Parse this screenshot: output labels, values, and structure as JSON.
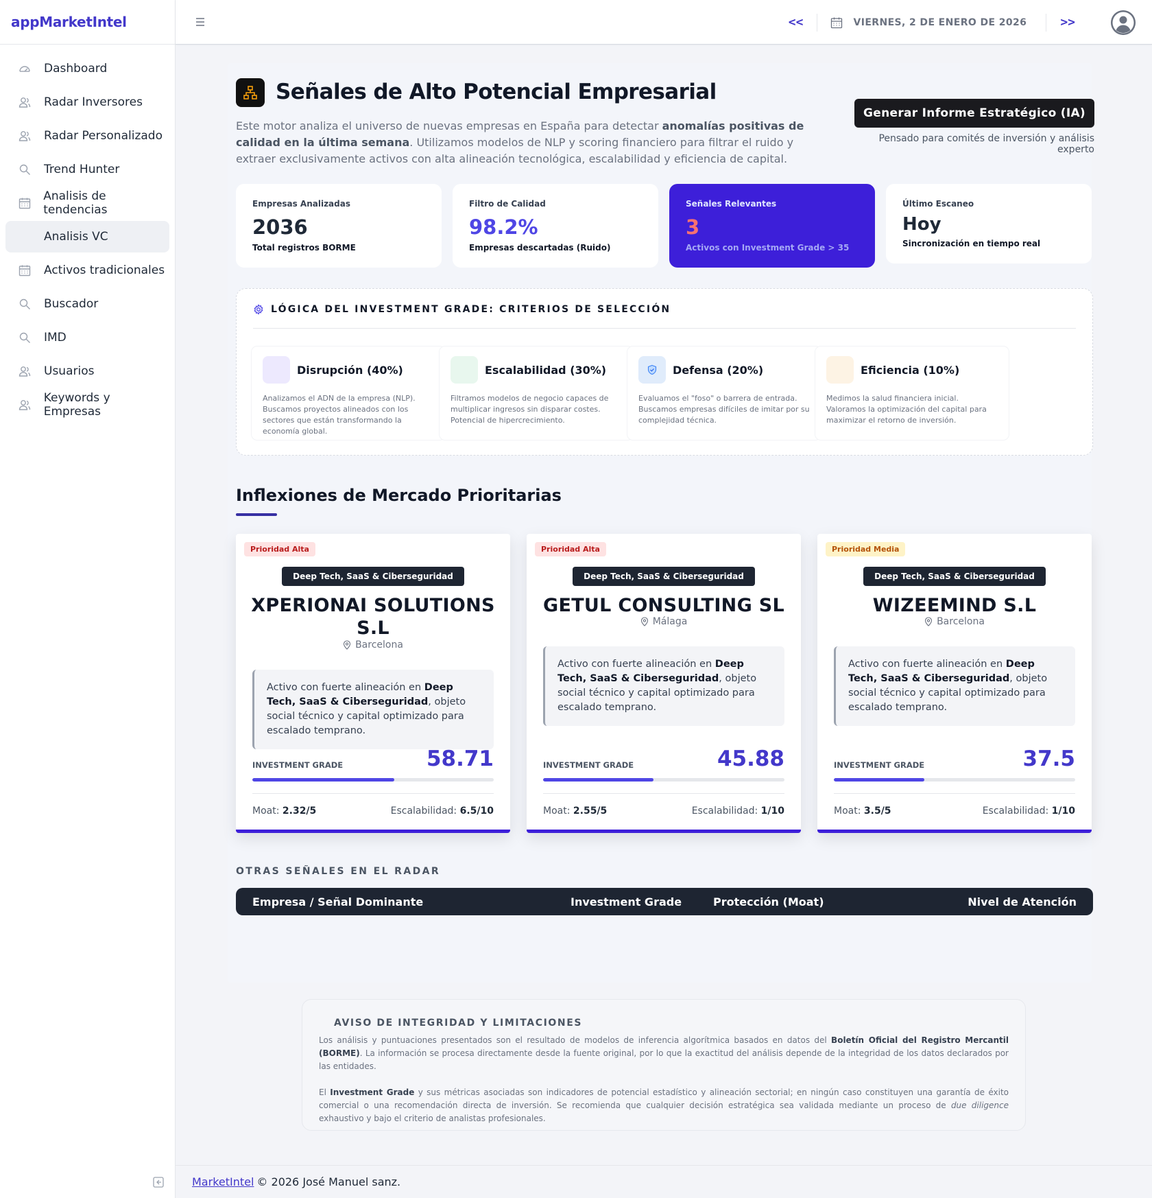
{
  "brand": "appMarketIntel",
  "sidebar": {
    "items": [
      {
        "label": "Dashboard",
        "icon": "dashboard-gauge-icon"
      },
      {
        "label": "Radar Inversores",
        "icon": "users-icon"
      },
      {
        "label": "Radar Personalizado",
        "icon": "users-icon"
      },
      {
        "label": "Trend Hunter",
        "icon": "search-icon"
      },
      {
        "label": "Analisis de tendencias",
        "icon": "calendar-icon"
      },
      {
        "label": "Analisis VC",
        "icon": "none",
        "active": true
      },
      {
        "label": "Activos tradicionales",
        "icon": "calendar-icon"
      },
      {
        "label": "Buscador",
        "icon": "search-icon"
      },
      {
        "label": "IMD",
        "icon": "search-icon"
      },
      {
        "label": "Usuarios",
        "icon": "users-icon"
      },
      {
        "label": "Keywords y Empresas",
        "icon": "users-icon"
      }
    ]
  },
  "topbar": {
    "prev_label": "<<",
    "next_label": ">>",
    "date": "VIERNES, 2 DE ENERO DE 2026"
  },
  "header": {
    "title": "Señales de Alto Potencial Empresarial",
    "intro_1": "Este motor analiza el universo de nuevas empresas en España para detectar ",
    "intro_bold": "anomalías positivas de calidad en la última semana",
    "intro_2": ". Utilizamos modelos de NLP y scoring financiero para filtrar el ruido y extraer exclusivamente activos con alta alineación tecnológica, escalabilidad y eficiencia de capital.",
    "cta_label": "Generar Informe Estratégico (IA)",
    "cta_sub": "Pensado para comités de inversión y análisis experto"
  },
  "stats": [
    {
      "label": "Empresas Analizadas",
      "value": "2036",
      "sub": "Total registros BORME"
    },
    {
      "label": "Filtro de Calidad",
      "value": "98.2%",
      "sub": "Empresas descartadas (Ruido)"
    },
    {
      "label": "Señales Relevantes",
      "value": "3",
      "sub": "Activos con Investment Grade > 35"
    },
    {
      "label": "Último Escaneo",
      "value": "Hoy",
      "sub": "Sincronización en tiempo real"
    }
  ],
  "criteria": {
    "title": "LÓGICA DEL INVESTMENT GRADE: CRITERIOS DE SELECCIÓN",
    "items": [
      {
        "name": "Disrupción (40%)",
        "desc": "Analizamos el ADN de la empresa (NLP). Buscamos proyectos alineados con los sectores que están transformando la economía global.",
        "color": "#ede9fe"
      },
      {
        "name": "Escalabilidad (30%)",
        "desc": "Filtramos modelos de negocio capaces de multiplicar ingresos sin disparar costes. Potencial de hipercrecimiento.",
        "color": "#e8f7ee"
      },
      {
        "name": "Defensa (20%)",
        "desc": "Evaluamos el \"foso\" o barrera de entrada. Buscamos empresas difíciles de imitar por su complejidad técnica.",
        "color": "#e0ecfb"
      },
      {
        "name": "Eficiencia (10%)",
        "desc": "Medimos la salud financiera inicial. Valoramos la optimización del capital para maximizar el retorno de inversión.",
        "color": "#fdf3e4"
      }
    ]
  },
  "section_title": "Inflexiones de Mercado Prioritarias",
  "cards": [
    {
      "priority": "Prioridad Alta",
      "sector": "Deep Tech, SaaS & Ciberseguridad",
      "name": "XPERIONAI SOLUTIONS S.L",
      "city": "Barcelona",
      "q1": "Activo con fuerte alineación en ",
      "qb": "Deep Tech, SaaS & Ciberseguridad",
      "q2": ", objeto social técnico y capital optimizado para escalado temprano.",
      "ig_label": "INVESTMENT GRADE",
      "ig": "58.71",
      "ig_fraction": 0.5871,
      "moat_label": "Moat:",
      "moat": "2.32/5",
      "esc_label": "Escalabilidad:",
      "esc": "6.5/10"
    },
    {
      "priority": "Prioridad Alta",
      "sector": "Deep Tech, SaaS & Ciberseguridad",
      "name": "GETUL CONSULTING SL",
      "city": "Málaga",
      "q1": "Activo con fuerte alineación en ",
      "qb": "Deep Tech, SaaS & Ciberseguridad",
      "q2": ", objeto social técnico y capital optimizado para escalado temprano.",
      "ig_label": "INVESTMENT GRADE",
      "ig": "45.88",
      "ig_fraction": 0.4588,
      "moat_label": "Moat:",
      "moat": "2.55/5",
      "esc_label": "Escalabilidad:",
      "esc": "1/10"
    },
    {
      "priority": "Prioridad Media",
      "sector": "Deep Tech, SaaS & Ciberseguridad",
      "name": "WIZEEMIND S.L",
      "city": "Barcelona",
      "q1": "Activo con fuerte alineación en ",
      "qb": "Deep Tech, SaaS & Ciberseguridad",
      "q2": ", objeto social técnico y capital optimizado para escalado temprano.",
      "ig_label": "INVESTMENT GRADE",
      "ig": "37.5",
      "ig_fraction": 0.375,
      "moat_label": "Moat:",
      "moat": "3.5/5",
      "esc_label": "Escalabilidad:",
      "esc": "1/10"
    }
  ],
  "radar": {
    "title": "OTRAS SEÑALES EN EL RADAR",
    "columns": [
      "Empresa / Señal Dominante",
      "Investment Grade",
      "Protección (Moat)",
      "Nivel de Atención"
    ]
  },
  "disclaimer": {
    "title": "AVISO DE INTEGRIDAD Y LIMITACIONES",
    "p1a": "Los análisis y puntuaciones presentados son el resultado de modelos de inferencia algorítmica basados en datos del ",
    "p1b": "Boletín Oficial del Registro Mercantil (BORME)",
    "p1c": ". La información se procesa directamente desde la fuente original, por lo que la exactitud del análisis depende de la integridad de los datos declarados por las entidades.",
    "p2a": "El ",
    "p2b": "Investment Grade",
    "p2c": " y sus métricas asociadas son indicadores de potencial estadístico y alineación sectorial; en ningún caso constituyen una garantía de éxito comercial o una recomendación directa de inversión. Se recomienda que cualquier decisión estratégica sea validada mediante un proceso de ",
    "p2d": "due diligence",
    "p2e": " exhaustivo y bajo el criterio de analistas profesionales."
  },
  "footer": {
    "link": "MarketIntel",
    "text": "© 2026 José Manuel sanz."
  }
}
